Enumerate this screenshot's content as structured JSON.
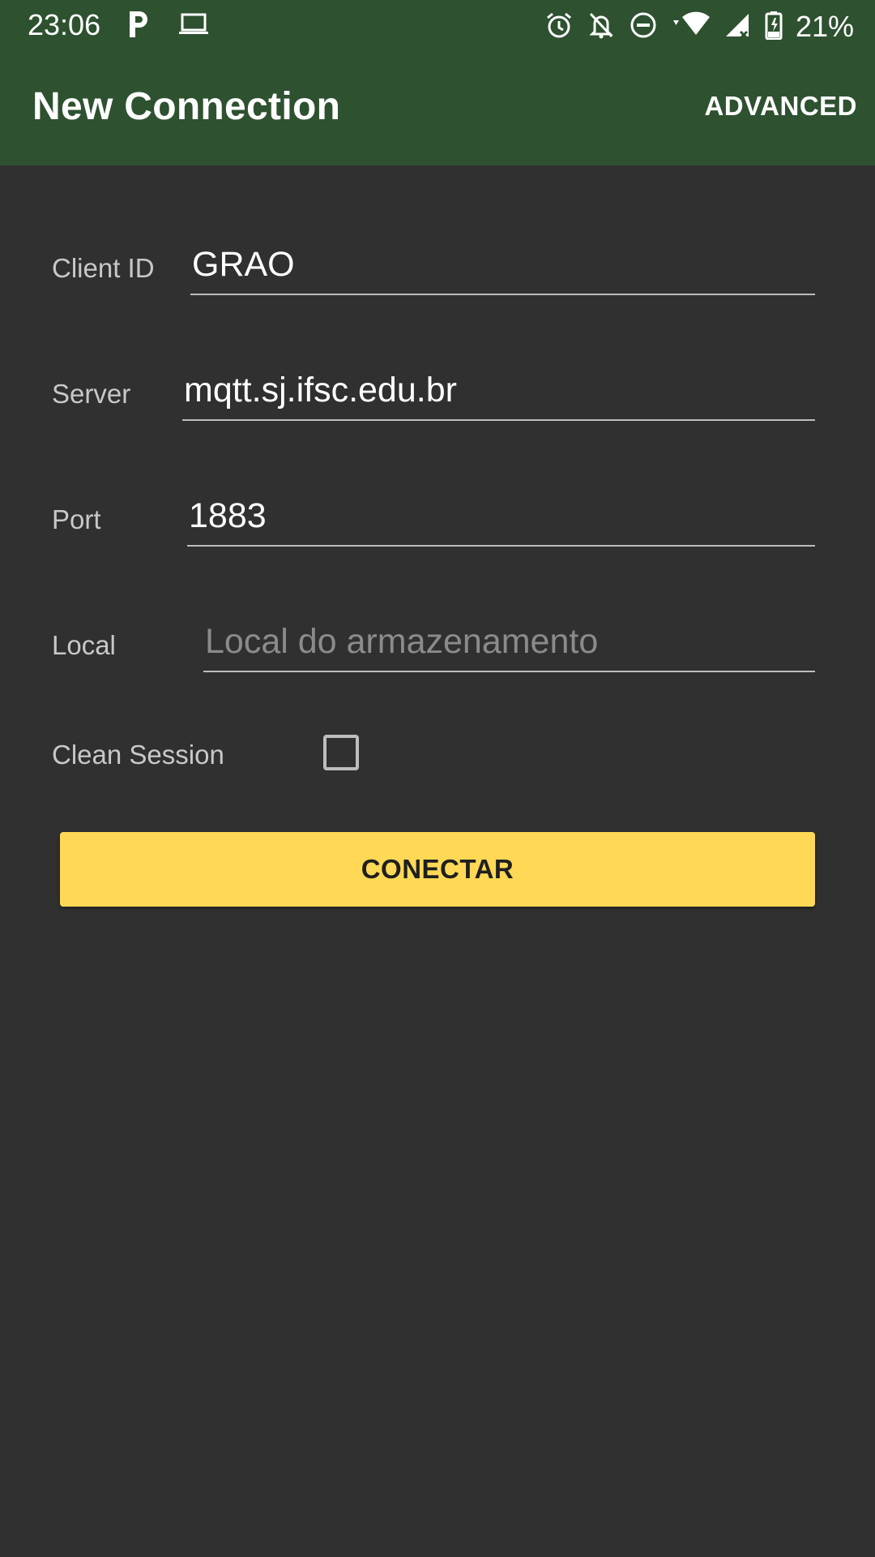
{
  "status_bar": {
    "time": "23:06",
    "battery": "21%",
    "icons": [
      "parking-icon",
      "laptop-icon",
      "alarm-icon",
      "notifications-off-icon",
      "do-not-disturb-icon",
      "wifi-icon",
      "signal-icon",
      "battery-icon"
    ]
  },
  "app_bar": {
    "title": "New Connection",
    "action": "ADVANCED",
    "color": "#2e5130"
  },
  "form": {
    "client_id": {
      "label": "Client ID",
      "value": "GRAO"
    },
    "server": {
      "label": "Server",
      "value": "mqtt.sj.ifsc.edu.br"
    },
    "port": {
      "label": "Port",
      "value": "1883"
    },
    "local": {
      "label": "Local",
      "value": "",
      "placeholder": "Local do armazenamento"
    },
    "clean_session": {
      "label": "Clean Session",
      "checked": false
    }
  },
  "connect_button": {
    "label": "CONECTAR",
    "color": "#ffd955"
  }
}
